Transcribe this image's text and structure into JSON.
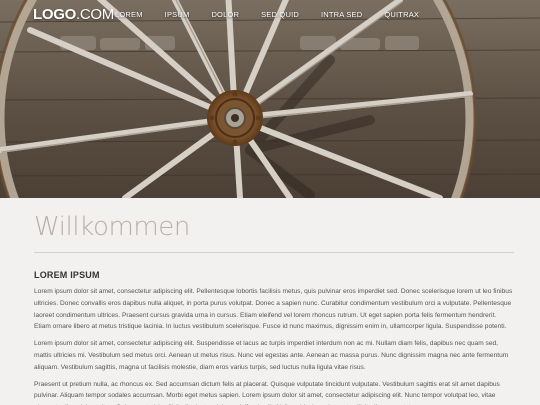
{
  "brand": {
    "logo_bold": "LOGO",
    "logo_suffix": ".COM"
  },
  "nav": {
    "items": [
      {
        "label": "LOREM"
      },
      {
        "label": "IPSUM"
      },
      {
        "label": "DOLOR"
      },
      {
        "label": "SED QUID"
      },
      {
        "label": "INTRA SED"
      },
      {
        "label": "QUITRAX"
      }
    ]
  },
  "main": {
    "title": "Willkommen",
    "subtitle": "LOREM IPSUM",
    "paragraphs": [
      "Lorem ipsum dolor sit amet, consectetur adipiscing elit. Pellentesque lobortis facilisis metus, quis pulvinar eros imperdiet sed. Donec scelerisque lorem ut leo finibus ultricies. Donec convallis eros dapibus nulla aliquet, in porta purus volutpat. Donec a sapien nunc. Curabitur condimentum vestibulum orci a vulputate. Pellentesque laoreet condimentum ultrices. Praesent cursus gravida urna in cursus. Etiam eleifend vel lorem rhoncus rutrum. Ut eget sapien porta felis fermentum hendrerit. Etiam ornare libero at metus tristique lacinia. In luctus vestibulum scelerisque. Fusce id nunc maximus, dignissim enim in, ullamcorper ligula. Suspendisse potenti.",
      "Lorem ipsum dolor sit amet, consectetur adipiscing elit. Suspendisse et lacus ac turpis imperdiet interdum non ac mi. Nullam diam felis, dapibus nec quam sed, mattis ultricies mi. Vestibulum sed metus orci. Aenean ut metus risus. Nunc vel egestas ante. Aenean ac massa purus. Nunc dignissim magna nec ante fermentum aliquam. Vestibulum sagittis, magna ut facilisis molestie, diam eros varius turpis, sed luctus nulla ligula vitae risus.",
      "Praesent ut pretium nulla, ac rhoncus ex. Sed accumsan dictum felis at placerat. Quisque vulputate tincidunt vulputate. Vestibulum sagittis erat sit amet dapibus pulvinar. Aliquam tempor sodales accumsan. Morbi eget metus sapien. Lorem ipsum dolor sit amet, consectetur adipiscing elit. Nunc tempor volutpat leo, vitae placerat odio pulvinar vitae. Quisque et nisl sollicitudin, luctus dui ac, eleifend velit. Nulla vehicula orci a erat sollicitudin consectetur."
    ]
  },
  "colors": {
    "background": "#f3f1ef",
    "title": "#b9aeaa",
    "body_text": "#555555",
    "heading": "#333333"
  }
}
